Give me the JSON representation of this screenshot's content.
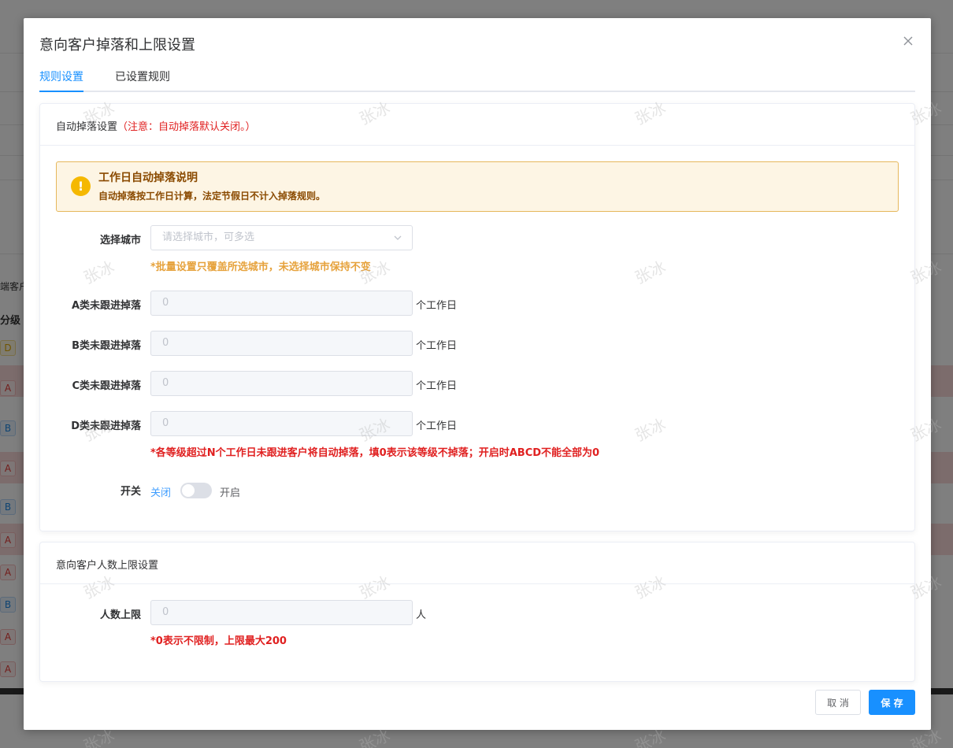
{
  "dialog": {
    "title": "意向客户掉落和上限设置",
    "tabs": [
      {
        "label": "规则设置",
        "active": true
      },
      {
        "label": "已设置规则",
        "active": false
      }
    ]
  },
  "auto_drop": {
    "header": "自动掉落设置",
    "header_note": "（注意：自动掉落默认关闭。）",
    "alert": {
      "title": "工作日自动掉落说明",
      "desc": "自动掉落按工作日计算，法定节假日不计入掉落规则。",
      "icon": "!"
    },
    "city": {
      "label": "选择城市",
      "placeholder": "请选择城市，可多选",
      "hint": "*批量设置只覆盖所选城市，未选择城市保持不变"
    },
    "grades": [
      {
        "label": "A类未跟进掉落",
        "value": "0",
        "suffix": "个工作日"
      },
      {
        "label": "B类未跟进掉落",
        "value": "0",
        "suffix": "个工作日"
      },
      {
        "label": "C类未跟进掉落",
        "value": "0",
        "suffix": "个工作日"
      },
      {
        "label": "D类未跟进掉落",
        "value": "0",
        "suffix": "个工作日"
      }
    ],
    "grades_hint": "*各等级超过N个工作日未跟进客户将自动掉落，填0表示该等级不掉落；开启时ABCD不能全部为0",
    "switch": {
      "label": "开关",
      "off_label": "关闭",
      "on_label": "开启",
      "state": "off"
    }
  },
  "limit": {
    "header": "意向客户人数上限设置",
    "label": "人数上限",
    "value": "0",
    "suffix": "人",
    "hint": "*0表示不限制，上限最大200"
  },
  "footer": {
    "cancel_label": "取 消",
    "save_label": "保 存"
  },
  "background": {
    "column_header": "分级",
    "cell_text": "端客户",
    "tags": [
      "D",
      "A",
      "B",
      "A",
      "B",
      "A",
      "A",
      "B",
      "A",
      "A"
    ]
  },
  "watermark": "张冰",
  "colors": {
    "primary": "#1890ff",
    "danger": "#e02020",
    "warning": "#e6a23c",
    "alert_bg": "#fdf5e4"
  }
}
